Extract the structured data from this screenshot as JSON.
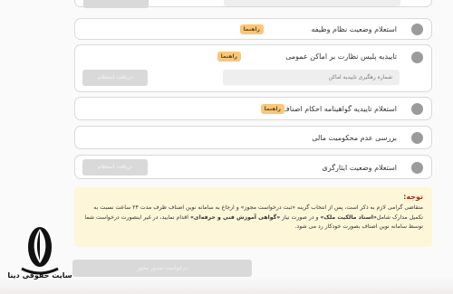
{
  "rows": [
    {
      "label": "استعلام وضعیت نظام وظیفه",
      "guide": "راهنما"
    },
    {
      "label": "تاییدیه پلیس نظارت بر اماکن عمومی",
      "guide": "راهنما",
      "input_placeholder": "شماره رهگیری تاییدیه اماکن",
      "button": "دریافت استعلام"
    },
    {
      "label": "استعلام تاییدیه گواهینامه احکام اصناف",
      "guide": "راهنما"
    },
    {
      "label": "بررسی عدم محکومیت مالی"
    },
    {
      "label": "استعلام وضعیت ایثارگری",
      "button": "دریافت استعلام"
    }
  ],
  "note": {
    "title": "توجه:",
    "text_1": "متقاضی گرامی لازم به ذکر است، پس از انتخاب گزینه «ثبت درخواست مجوز» و ارجاع به سامانه نوین اصناف ظرف مدت ۲۴ ساعت نسبت به تکمیل مدارک شامل",
    "bold_1": "«اسناد مالکیت ملک»",
    "text_2": " و در صورت نیاز ",
    "bold_2": "«گواهی آموزش فنی و حرفه‌ای»",
    "text_3": " اقدام نمایید، در غیر اینصورت درخواست شما توسط سامانه نوین اصناف بصورت خودکار رد می شود."
  },
  "submit_label": "درخواست صدور مجوز",
  "brand_name": "سایت حقوقی دینا"
}
